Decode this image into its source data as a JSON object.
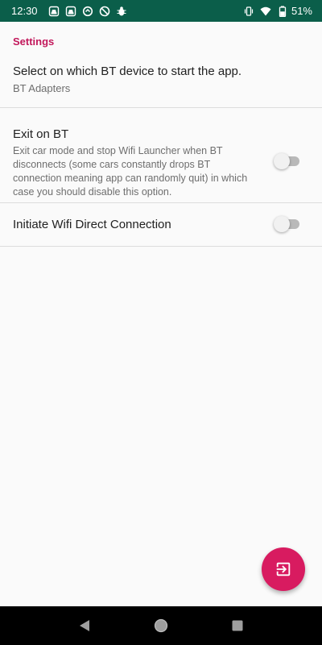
{
  "status_bar": {
    "time": "12:30",
    "battery": "51%",
    "left_icons": [
      "car-mode-icon",
      "car-mode-icon",
      "sync-icon",
      "do-not-disturb-icon",
      "bug-icon"
    ],
    "right_icons": [
      "vibrate-icon",
      "wifi-icon",
      "battery-icon"
    ]
  },
  "settings": {
    "section_title": "Settings",
    "bt_device": {
      "title": "Select on which BT device to start the app.",
      "summary": "BT Adapters"
    },
    "exit_on_bt": {
      "title": "Exit on BT",
      "summary": "Exit car mode and stop Wifi Launcher when BT disconnects (some cars constantly drops BT connection meaning app can randomly quit) in which case you should disable this option.",
      "enabled": false
    },
    "wifi_direct": {
      "title": "Initiate Wifi Direct Connection",
      "enabled": false
    }
  },
  "fab": {
    "icon": "exit-to-app-icon"
  },
  "nav_bar": {
    "buttons": [
      "back-icon",
      "home-icon",
      "recents-icon"
    ]
  },
  "colors": {
    "status_bar": "#0b5e4a",
    "accent": "#c2185b",
    "fab": "#d81b60"
  }
}
